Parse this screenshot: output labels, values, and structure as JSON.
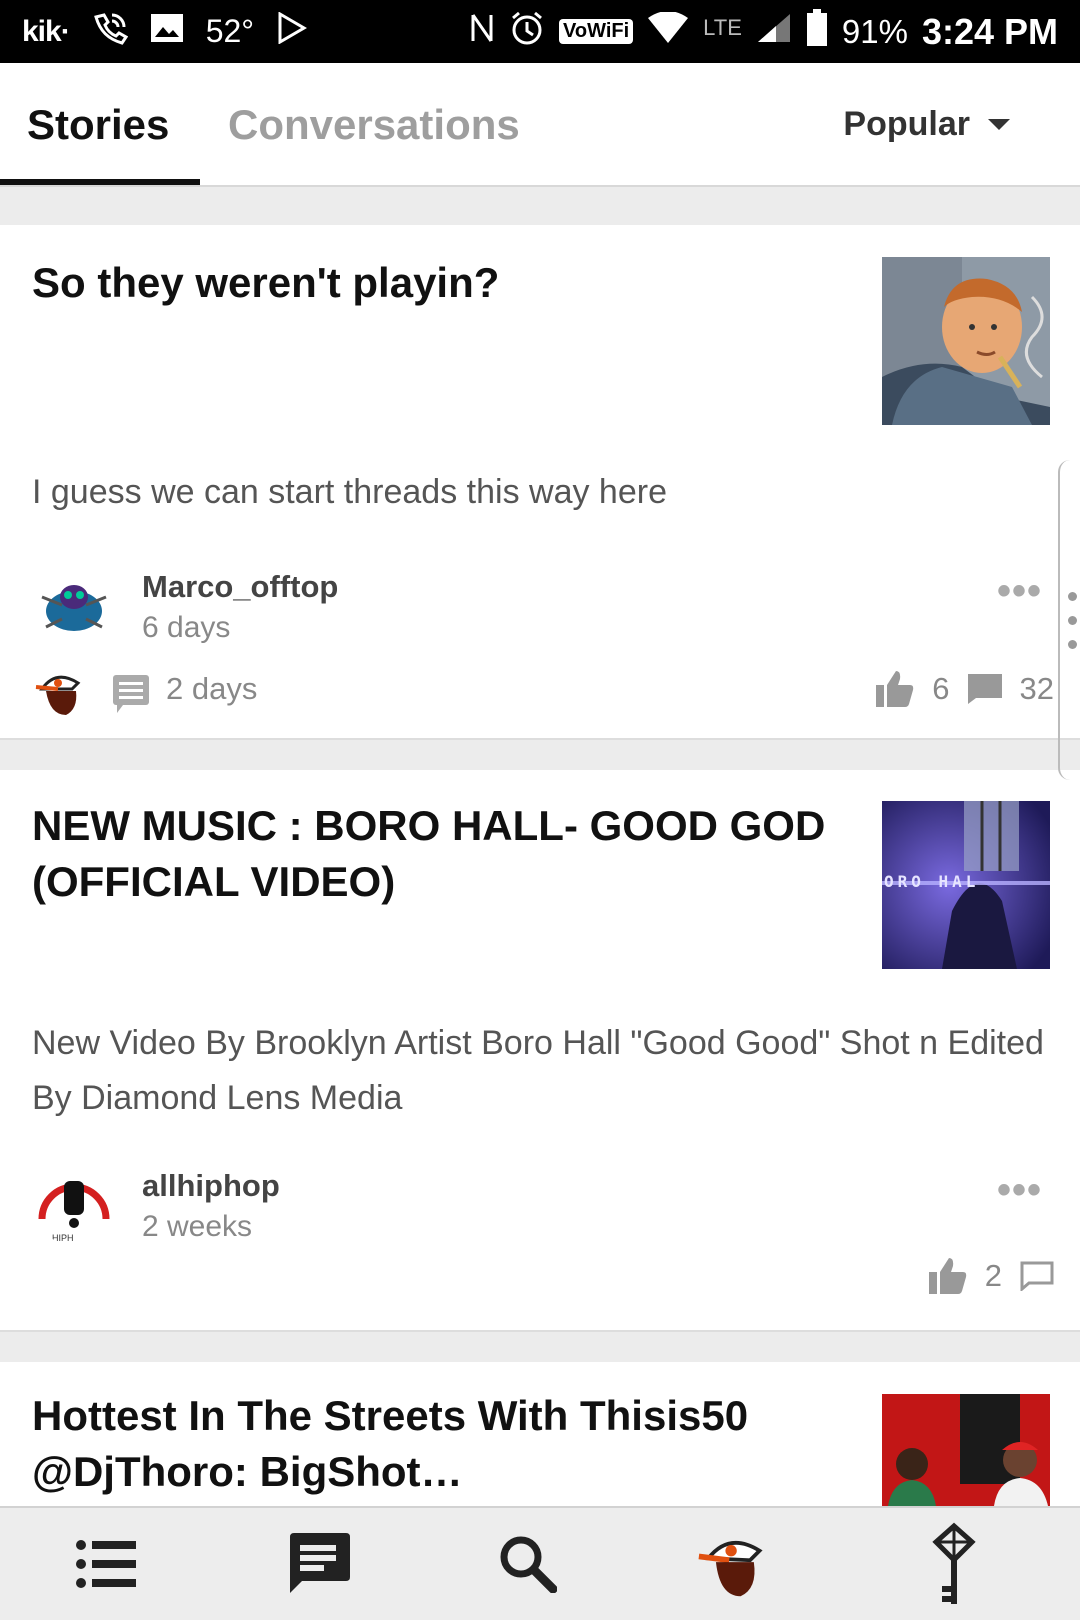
{
  "status_bar": {
    "kik": "kik·",
    "temp": "52°",
    "vowifi": "VoWiFi",
    "lte": "LTE",
    "battery": "91%",
    "time": "3:24 PM"
  },
  "tabs": {
    "stories": "Stories",
    "conversations": "Conversations",
    "sort": "Popular"
  },
  "posts": [
    {
      "title": "So they weren't playin?",
      "description": "I guess we can start threads this way here",
      "author": "Marco_offtop",
      "age": "6 days",
      "more": "•••",
      "reply_age": "2 days",
      "likes": "6",
      "comments": "32"
    },
    {
      "title": "NEW MUSIC : BORO HALL- GOOD GOD (OFFICIAL VIDEO)",
      "thumb_text": "ORO HAL",
      "description": "New Video By Brooklyn Artist Boro Hall \"Good Good\" Shot n Edited By Diamond Lens Media",
      "author": "allhiphop",
      "avatar_text": "HIPH",
      "age": "2 weeks",
      "more": "•••",
      "likes": "2"
    },
    {
      "title": "Hottest In The Streets With Thisis50 @DjThoro: BigShot…"
    }
  ],
  "icons": {
    "nav": [
      "list-icon",
      "chat-icon",
      "search-icon",
      "profile-avatar-icon",
      "key-icon"
    ]
  },
  "colors": {
    "accent": "#111111",
    "muted": "#888888",
    "nav_bg": "#ededed"
  }
}
